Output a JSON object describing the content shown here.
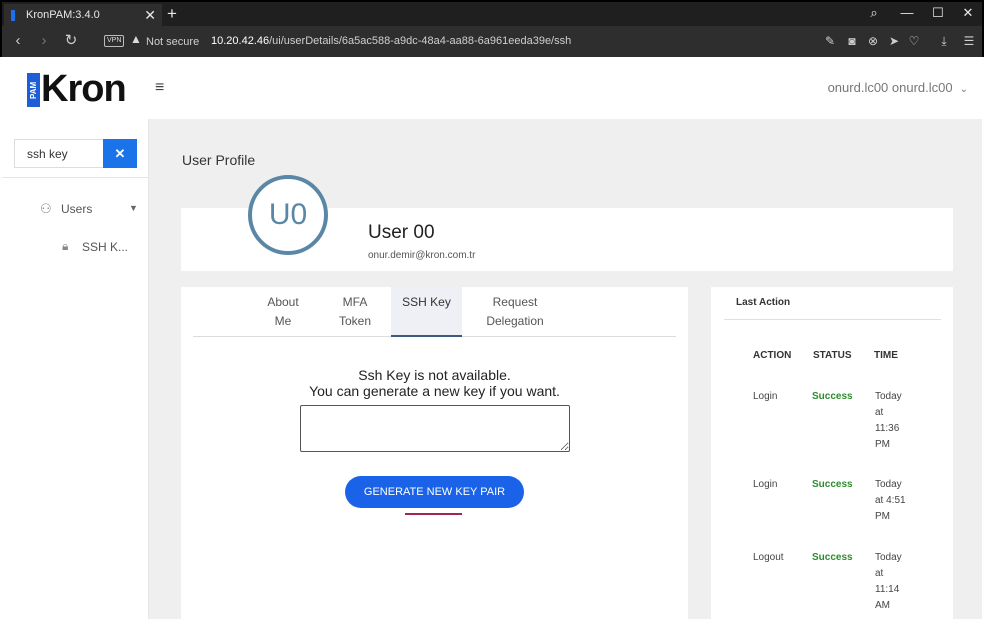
{
  "browser": {
    "tab_title": "KronPAM:3.4.0",
    "tab_close": "✕",
    "new_tab": "+",
    "vpn_badge": "VPN",
    "security": "Not secure",
    "url_host": "10.20.42.46",
    "url_path": "/ui/userDetails/6a5ac588-a9dc-48a4-aa88-6a961eeda39e/ssh",
    "icons": [
      "back-icon",
      "forward-icon",
      "reload-icon",
      "search-icon",
      "minimize-icon",
      "maximize-icon",
      "close-icon",
      "edit-icon",
      "camera-icon",
      "block-icon",
      "send-icon",
      "heart-icon",
      "download-icon",
      "menu-icon"
    ]
  },
  "header": {
    "logo_badge": "PAM",
    "logo_text": "Kron",
    "menu_glyph": "≡",
    "user": "onurd.lc00 onurd.lc00",
    "chevron": "⌄"
  },
  "sidebar": {
    "search_value": "ssh key",
    "clear": "✕",
    "items": [
      {
        "label": "Users",
        "icon": "user-icon"
      },
      {
        "label": "SSH K...",
        "icon": "lock-icon"
      }
    ]
  },
  "page": {
    "title": "User Profile"
  },
  "profile": {
    "initials": "U0",
    "name": "User 00",
    "email": "onur.demir@kron.com.tr"
  },
  "tabs": [
    {
      "line1": "About",
      "line2": "Me"
    },
    {
      "line1": "MFA",
      "line2": "Token"
    },
    {
      "line1": "SSH Key",
      "line2": ""
    },
    {
      "line1": "Request",
      "line2": "Delegation"
    }
  ],
  "ssh": {
    "line1": "Ssh Key is not available.",
    "line2": "You can generate a new key if you want.",
    "button": "GENERATE NEW KEY PAIR"
  },
  "last_action": {
    "title": "Last Action",
    "columns": [
      "ACTION",
      "STATUS",
      "TIME"
    ],
    "rows": [
      {
        "action": "Login",
        "status": "Success",
        "time": [
          "Today",
          "at",
          "11:36",
          "PM"
        ]
      },
      {
        "action": "Login",
        "status": "Success",
        "time": [
          "Today",
          "at 4:51",
          "PM"
        ]
      },
      {
        "action": "Logout",
        "status": "Success",
        "time": [
          "Today",
          "at",
          "11:14",
          "AM"
        ]
      }
    ]
  },
  "colors": {
    "accent": "#1a63e8",
    "avatar": "#5b87a6",
    "success": "#2e8b2e"
  }
}
